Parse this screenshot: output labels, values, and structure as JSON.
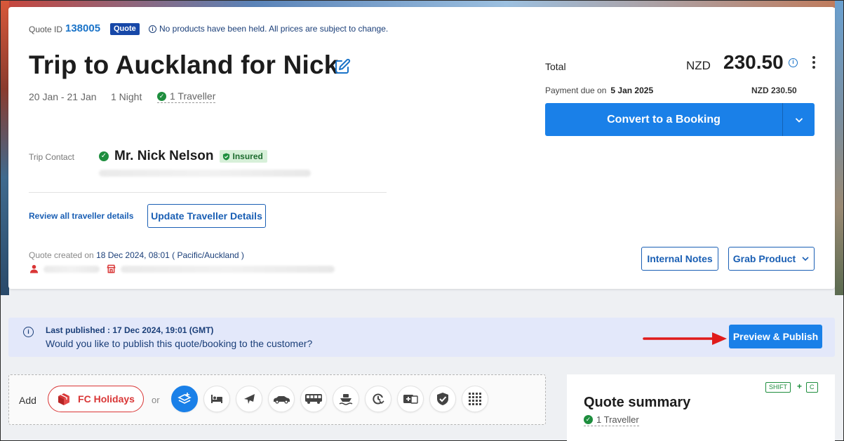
{
  "quote": {
    "id_label": "Quote ID",
    "id_value": "138005",
    "badge": "Quote",
    "notice": "No products have been held. All prices are subject to change."
  },
  "trip": {
    "title": "Trip to Auckland for Nick",
    "dates": "20 Jan - 21 Jan",
    "nights": "1 Night",
    "travellers": "1 Traveller"
  },
  "contact": {
    "label": "Trip Contact",
    "name": "Mr. Nick Nelson",
    "insured": "Insured"
  },
  "actions": {
    "review_link": "Review all traveller details",
    "update_button": "Update Traveller Details",
    "internal_notes": "Internal Notes",
    "grab_product": "Grab Product"
  },
  "created": {
    "prefix": "Quote created on",
    "datetime": "18 Dec 2024, 08:01",
    "timezone": "( Pacific/Auckland )"
  },
  "total": {
    "label": "Total",
    "currency": "NZD",
    "value": "230.50",
    "payment_due_label": "Payment due on",
    "payment_due_date": "5 Jan 2025",
    "payment_due_amount": "NZD 230.50",
    "convert_button": "Convert to a Booking"
  },
  "publish": {
    "last_published": "Last published : 17 Dec 2024, 19:01 (GMT)",
    "question": "Would you like to publish this quote/booking to the customer?",
    "button": "Preview & Publish"
  },
  "add_products": {
    "add_label": "Add",
    "fc_button": "FC Holidays",
    "or_label": "or",
    "product_icons": [
      "package-icon",
      "hotel-icon",
      "flight-icon",
      "car-icon",
      "bus-icon",
      "ferry-icon",
      "transfer-icon",
      "activity-icon",
      "insurance-icon",
      "more-grid-icon"
    ]
  },
  "summary": {
    "shortcut_key1": "SHIFT",
    "shortcut_plus": "+",
    "shortcut_key2": "C",
    "title": "Quote summary",
    "travellers": "1 Traveller"
  },
  "colors": {
    "primary": "#1a80e8",
    "link": "#1a5fb4",
    "success": "#1e8e3e",
    "danger": "#d93636",
    "badge": "#1748a8",
    "publish_bar": "#e3e8fa"
  }
}
